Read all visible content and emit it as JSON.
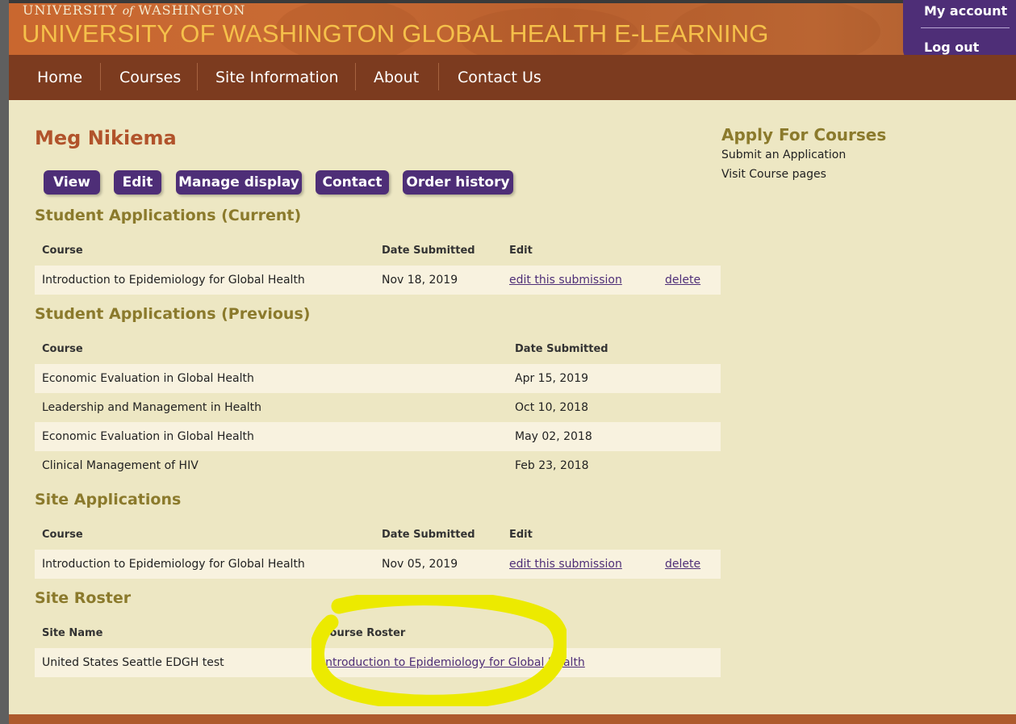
{
  "header": {
    "uw_left": "UNIVERSITY",
    "uw_of": "of",
    "uw_right": "WASHINGTON",
    "site_title": "UNIVERSITY OF WASHINGTON GLOBAL HEALTH E-LEARNING"
  },
  "account": {
    "my_account": "My account",
    "log_out": "Log out"
  },
  "nav": [
    "Home",
    "Courses",
    "Site Information",
    "About",
    "Contact Us"
  ],
  "page_title": "Meg Nikiema",
  "tabs": [
    "View",
    "Edit",
    "Manage display",
    "Contact",
    "Order history"
  ],
  "current_apps": {
    "heading": "Student Applications (Current)",
    "headers": [
      "Course",
      "Date Submitted",
      "Edit"
    ],
    "rows": [
      {
        "course": "Introduction to Epidemiology for Global Health",
        "date": "Nov 18, 2019",
        "edit": "edit this submission",
        "delete": "delete"
      }
    ]
  },
  "previous_apps": {
    "heading": "Student Applications (Previous)",
    "headers": [
      "Course",
      "Date Submitted"
    ],
    "rows": [
      {
        "course": "Economic Evaluation in Global Health",
        "date": "Apr 15, 2019"
      },
      {
        "course": "Leadership and Management in Health",
        "date": "Oct 10, 2018"
      },
      {
        "course": "Economic Evaluation in Global Health",
        "date": "May 02, 2018"
      },
      {
        "course": "Clinical Management of HIV",
        "date": "Feb 23, 2018"
      }
    ]
  },
  "site_apps": {
    "heading": "Site Applications",
    "headers": [
      "Course",
      "Date Submitted",
      "Edit"
    ],
    "rows": [
      {
        "course": "Introduction to Epidemiology for Global Health",
        "date": "Nov 05, 2019",
        "edit": "edit this submission",
        "delete": "delete"
      }
    ]
  },
  "site_roster": {
    "heading": "Site Roster",
    "headers": [
      "Site Name",
      "Course Roster"
    ],
    "rows": [
      {
        "site": "United States Seattle EDGH test",
        "course": "Introduction to Epidemiology for Global Health"
      }
    ]
  },
  "sidebar": {
    "heading": "Apply For Courses",
    "links": [
      "Submit an Application",
      "Visit Course pages"
    ]
  },
  "colors": {
    "header_orange": "#c9672f",
    "nav_brown": "#7c3b1f",
    "content_bg": "#ede7c3",
    "purple": "#4e2e77",
    "title_gold": "#f5c04a",
    "section_olive": "#8b7a2c",
    "highlight_yellow": "#ecea00"
  }
}
